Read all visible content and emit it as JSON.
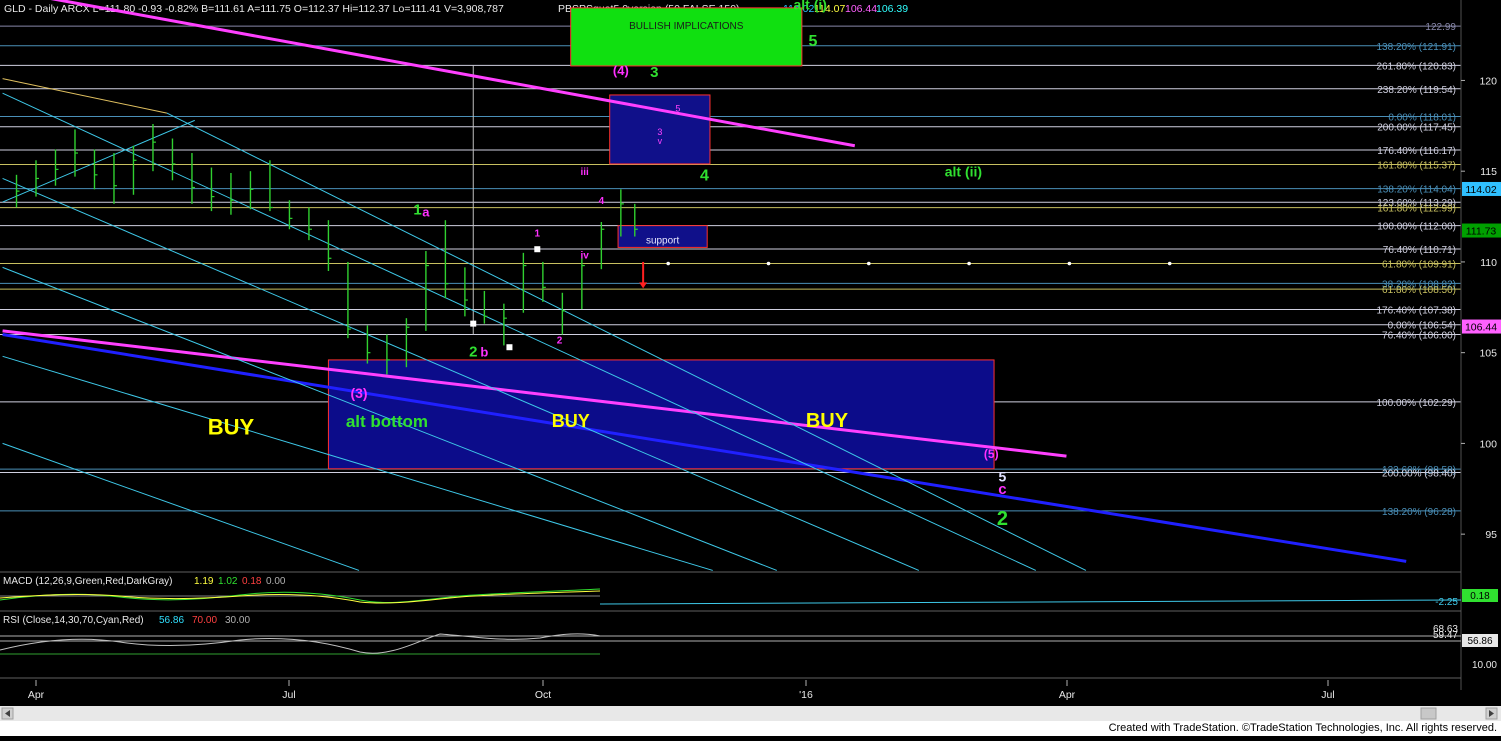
{
  "window": {
    "symbol_line": "GLD - Daily  ARCX  L=111.80  -0.93  -0.82%  B=111.61  A=111.75  O=112.37  Hi=112.37  Lo=111.41  V=3,908,787",
    "study_name": "PBSPSquat5.0version (50,FALSE,150)",
    "study_values": [
      "114.02",
      "114.07",
      "106.44",
      "106.39"
    ],
    "study_value_colors": [
      "#30c0ff",
      "#ffff40",
      "#ff60ff",
      "#30ffff"
    ],
    "footer": "Created with TradeStation. ©TradeStation Technologies, Inc. All rights reserved."
  },
  "chart_data": {
    "type": "candlestick",
    "symbol": "GLD",
    "interval": "Daily",
    "ylim": [
      93,
      124
    ],
    "y_ticks": [
      95,
      100,
      105,
      110,
      115,
      120
    ],
    "x_ticks": [
      "Apr",
      "Jul",
      "Oct",
      "'16",
      "Apr",
      "Jul"
    ],
    "last_price": 111.73,
    "price_tags": [
      {
        "value": 114.02,
        "label": "114.02",
        "color": "#30c0ff"
      },
      {
        "value": 111.73,
        "label": "111.73",
        "color": "#00a000"
      },
      {
        "value": 106.44,
        "label": "106.44",
        "color": "#ff60ff"
      }
    ],
    "fib_levels": [
      {
        "value": 122.99,
        "label": "122.99",
        "color": "#8888aa"
      },
      {
        "value": 121.91,
        "label": "138.20% (121.91)",
        "color": "#4a8fb8"
      },
      {
        "value": 120.83,
        "label": "261.80% (120.83)",
        "color": "#d0d0e0"
      },
      {
        "value": 119.54,
        "label": "238.20% (119.54)",
        "color": "#d0d0e0"
      },
      {
        "value": 118.01,
        "label": "0.00% (118.01)",
        "color": "#4a8fb8"
      },
      {
        "value": 117.45,
        "label": "200.00% (117.45)",
        "color": "#d0d0e0"
      },
      {
        "value": 116.17,
        "label": "176.40% (116.17)",
        "color": "#d0d0e0"
      },
      {
        "value": 115.37,
        "label": "161.80% (115.37)",
        "color": "#c8c060"
      },
      {
        "value": 114.04,
        "label": "138.20% (114.04)",
        "color": "#4a8fb8"
      },
      {
        "value": 113.29,
        "label": "123.60% (113.29)",
        "color": "#d0d0e0"
      },
      {
        "value": 112.99,
        "label": "161.80% (112.99)",
        "color": "#c8c060"
      },
      {
        "value": 112.0,
        "label": "100.00% (112.00)",
        "color": "#d0d0e0"
      },
      {
        "value": 110.71,
        "label": "76.40% (110.71)",
        "color": "#d0d0e0"
      },
      {
        "value": 109.91,
        "label": "61.80% (109.91)",
        "color": "#c8c060"
      },
      {
        "value": 108.82,
        "label": "38.20% (108.82)",
        "color": "#4a8fb8"
      },
      {
        "value": 108.5,
        "label": "61.80% (108.50)",
        "color": "#c8c060"
      },
      {
        "value": 107.38,
        "label": "176.40% (107.38)",
        "color": "#d0d0e0"
      },
      {
        "value": 106.54,
        "label": "0.00% (106.54)",
        "color": "#d0d0e0"
      },
      {
        "value": 106.0,
        "label": "76.40% (106.00)",
        "color": "#d0d0e0"
      },
      {
        "value": 102.29,
        "label": "100.00% (102.29)",
        "color": "#d0d0e0"
      },
      {
        "value": 98.58,
        "label": "123.60% (98.58)",
        "color": "#4a8fb8"
      },
      {
        "value": 98.4,
        "label": "200.00% (98.40)",
        "color": "#d0d0e0"
      },
      {
        "value": 96.28,
        "label": "138.20% (96.28)",
        "color": "#4a8fb8"
      }
    ],
    "price_bars": [
      {
        "date": "2015-03-25",
        "high": 114.8,
        "low": 113.0,
        "close": 113.9
      },
      {
        "date": "2015-04-01",
        "high": 115.6,
        "low": 113.6,
        "close": 114.6
      },
      {
        "date": "2015-04-08",
        "high": 116.2,
        "low": 114.2,
        "close": 115.1
      },
      {
        "date": "2015-04-15",
        "high": 117.3,
        "low": 114.7,
        "close": 116.0
      },
      {
        "date": "2015-04-22",
        "high": 116.2,
        "low": 114.0,
        "close": 114.8
      },
      {
        "date": "2015-04-29",
        "high": 116.0,
        "low": 113.2,
        "close": 114.2
      },
      {
        "date": "2015-05-06",
        "high": 116.4,
        "low": 113.7,
        "close": 115.6
      },
      {
        "date": "2015-05-13",
        "high": 117.6,
        "low": 115.0,
        "close": 116.6
      },
      {
        "date": "2015-05-20",
        "high": 116.8,
        "low": 114.5,
        "close": 115.4
      },
      {
        "date": "2015-05-27",
        "high": 116.0,
        "low": 113.2,
        "close": 114.1
      },
      {
        "date": "2015-06-03",
        "high": 115.2,
        "low": 112.8,
        "close": 113.6
      },
      {
        "date": "2015-06-10",
        "high": 114.9,
        "low": 112.6,
        "close": 113.4
      },
      {
        "date": "2015-06-17",
        "high": 115.0,
        "low": 112.9,
        "close": 114.0
      },
      {
        "date": "2015-06-24",
        "high": 115.6,
        "low": 112.8,
        "close": 113.0
      },
      {
        "date": "2015-07-01",
        "high": 113.4,
        "low": 111.8,
        "close": 112.4
      },
      {
        "date": "2015-07-08",
        "high": 113.0,
        "low": 111.2,
        "close": 111.8
      },
      {
        "date": "2015-07-15",
        "high": 112.3,
        "low": 109.5,
        "close": 110.2
      },
      {
        "date": "2015-07-22",
        "high": 110.0,
        "low": 105.8,
        "close": 106.3
      },
      {
        "date": "2015-07-29",
        "high": 106.5,
        "low": 104.4,
        "close": 105.0
      },
      {
        "date": "2015-08-05",
        "high": 106.0,
        "low": 103.8,
        "close": 104.6
      },
      {
        "date": "2015-08-12",
        "high": 106.9,
        "low": 104.2,
        "close": 106.4
      },
      {
        "date": "2015-08-19",
        "high": 110.6,
        "low": 106.2,
        "close": 109.8
      },
      {
        "date": "2015-08-26",
        "high": 112.3,
        "low": 108.0,
        "close": 108.8
      },
      {
        "date": "2015-09-02",
        "high": 109.7,
        "low": 107.0,
        "close": 107.9
      },
      {
        "date": "2015-09-09",
        "high": 108.4,
        "low": 106.6,
        "close": 107.0
      },
      {
        "date": "2015-09-16",
        "high": 107.7,
        "low": 105.4,
        "close": 106.9
      },
      {
        "date": "2015-09-23",
        "high": 110.5,
        "low": 107.2,
        "close": 109.8
      },
      {
        "date": "2015-09-30",
        "high": 110.0,
        "low": 107.8,
        "close": 108.6
      },
      {
        "date": "2015-10-07",
        "high": 108.3,
        "low": 106.0,
        "close": 107.3
      },
      {
        "date": "2015-10-14",
        "high": 110.2,
        "low": 107.4,
        "close": 109.8
      },
      {
        "date": "2015-10-21",
        "high": 112.2,
        "low": 109.6,
        "close": 111.8
      },
      {
        "date": "2015-10-28",
        "high": 114.0,
        "low": 111.4,
        "close": 113.2
      },
      {
        "date": "2015-11-02",
        "high": 113.2,
        "low": 111.4,
        "close": 111.8
      }
    ],
    "buy_zone": {
      "date_start": "2015-07-15",
      "date_end": "2016-03-10",
      "value_top": 104.6,
      "value_bottom": 98.6
    },
    "bullish_box": {
      "label": "BULLISH IMPLICATIONS",
      "date_start": "2015-10-10",
      "date_end": "2016-01-01",
      "value_top": 124.0,
      "value_bottom": 120.8
    },
    "target_box": {
      "labels": [
        "5",
        "3",
        "v"
      ],
      "date_start": "2015-10-24",
      "date_end": "2015-11-29",
      "value_top": 119.2,
      "value_bottom": 115.4
    },
    "support_box": {
      "label": "support",
      "date_start": "2015-10-27",
      "date_end": "2015-11-28",
      "value_top": 112.0,
      "value_bottom": 110.8
    },
    "dotted_level": {
      "value": 109.91,
      "date_start": "2015-11-14",
      "date_end": "2016-06-15"
    },
    "down_arrow": {
      "date": "2015-11-05",
      "value_from": 110.0,
      "value_to": 108.6
    },
    "trendlines": [
      {
        "color": "#ff40ff",
        "width": 3,
        "from": [
          "2015-03-20",
          125.0
        ],
        "to": [
          "2016-01-20",
          116.4
        ]
      },
      {
        "color": "#ff40ff",
        "width": 3,
        "from": [
          "2015-03-20",
          106.2
        ],
        "to": [
          "2016-04-05",
          99.3
        ]
      },
      {
        "color": "#2020ff",
        "width": 3,
        "from": [
          "2015-03-20",
          106.0
        ],
        "to": [
          "2016-08-05",
          93.5
        ]
      },
      {
        "color": "#3ec8e8",
        "width": 1,
        "from": [
          "2015-03-20",
          113.3
        ],
        "to": [
          "2015-05-28",
          117.8
        ]
      },
      {
        "color": "#3ec8e8",
        "width": 1,
        "from": [
          "2015-03-20",
          119.3
        ],
        "to": [
          "2016-03-25",
          93.0
        ]
      },
      {
        "color": "#3ec8e8",
        "width": 1,
        "from": [
          "2015-03-20",
          114.6
        ],
        "to": [
          "2016-02-12",
          93.0
        ]
      },
      {
        "color": "#3ec8e8",
        "width": 1,
        "from": [
          "2015-03-20",
          109.7
        ],
        "to": [
          "2015-12-23",
          93.0
        ]
      },
      {
        "color": "#3ec8e8",
        "width": 1,
        "from": [
          "2015-03-20",
          104.8
        ],
        "to": [
          "2015-11-30",
          93.0
        ]
      },
      {
        "color": "#3ec8e8",
        "width": 1,
        "from": [
          "2015-03-20",
          100.0
        ],
        "to": [
          "2015-07-26",
          93.0
        ]
      },
      {
        "color": "#3ec8e8",
        "width": 1,
        "from": [
          "2015-05-18",
          118.2
        ],
        "to": [
          "2016-04-12",
          93.0
        ]
      },
      {
        "color": "#e0c060",
        "width": 1,
        "from": [
          "2015-03-20",
          120.1
        ],
        "to": [
          "2015-05-18",
          118.2
        ]
      }
    ],
    "markers": [
      {
        "date": "2015-09-05",
        "value": 106.6
      },
      {
        "date": "2015-09-18",
        "value": 105.3
      },
      {
        "date": "2015-09-28",
        "value": 110.7
      }
    ],
    "annotations": [
      {
        "text": "alt (i)",
        "date": "2016-01-04",
        "value": 123.9,
        "color": "#30e030",
        "size": 14
      },
      {
        "text": "5",
        "date": "2016-01-05",
        "value": 121.9,
        "color": "#30e030",
        "size": 16
      },
      {
        "text": "(4)",
        "date": "2015-10-28",
        "value": 120.3,
        "color": "#ff30ff",
        "size": 13
      },
      {
        "text": "3",
        "date": "2015-11-09",
        "value": 120.2,
        "color": "#30e030",
        "size": 15
      },
      {
        "text": "4",
        "date": "2015-11-27",
        "value": 114.5,
        "color": "#30e030",
        "size": 16
      },
      {
        "text": "alt (ii)",
        "date": "2016-02-28",
        "value": 114.7,
        "color": "#30e030",
        "size": 14
      },
      {
        "text": "iii",
        "date": "2015-10-15",
        "value": 114.8,
        "color": "#ff30ff",
        "size": 10
      },
      {
        "text": "4",
        "date": "2015-10-21",
        "value": 113.2,
        "color": "#ff30ff",
        "size": 10
      },
      {
        "text": "iv",
        "date": "2015-10-15",
        "value": 110.2,
        "color": "#ff30ff",
        "size": 10
      },
      {
        "text": "1",
        "date": "2015-08-16",
        "value": 112.6,
        "color": "#30e030",
        "size": 15
      },
      {
        "text": "a",
        "date": "2015-08-19",
        "value": 112.5,
        "color": "#ff30ff",
        "size": 13
      },
      {
        "text": "1",
        "date": "2015-09-28",
        "value": 111.4,
        "color": "#ff30ff",
        "size": 10
      },
      {
        "text": "2",
        "date": "2015-09-05",
        "value": 104.8,
        "color": "#30e030",
        "size": 15
      },
      {
        "text": "b",
        "date": "2015-09-09",
        "value": 104.8,
        "color": "#ff30ff",
        "size": 13
      },
      {
        "text": "2",
        "date": "2015-10-06",
        "value": 105.5,
        "color": "#ff30ff",
        "size": 10
      },
      {
        "text": "(3)",
        "date": "2015-07-26",
        "value": 102.5,
        "color": "#ff30ff",
        "size": 14
      },
      {
        "text": "(5)",
        "date": "2016-03-09",
        "value": 99.2,
        "color": "#ff30ff",
        "size": 12
      },
      {
        "text": "5",
        "date": "2016-03-13",
        "value": 97.9,
        "color": "#e0e0ff",
        "size": 14
      },
      {
        "text": "c",
        "date": "2016-03-13",
        "value": 97.2,
        "color": "#ff30ff",
        "size": 15
      },
      {
        "text": "2",
        "date": "2016-03-13",
        "value": 95.5,
        "color": "#30e030",
        "size": 20
      }
    ],
    "zone_labels": [
      {
        "text": "BUY",
        "date": "2015-06-10",
        "value": 100.5,
        "color": "#ffff00",
        "size": 22
      },
      {
        "text": "alt bottom",
        "date": "2015-08-05",
        "value": 100.9,
        "color": "#30e030",
        "size": 17
      },
      {
        "text": "BUY",
        "date": "2015-10-10",
        "value": 100.9,
        "color": "#ffff00",
        "size": 18
      },
      {
        "text": "BUY",
        "date": "2016-01-10",
        "value": 100.9,
        "color": "#ffff00",
        "size": 20
      }
    ]
  },
  "macd_panel": {
    "title": "MACD (12,26,9,Green,Red,DarkGray)",
    "values": [
      "1.19",
      "1.02",
      "0.18",
      "0.00"
    ],
    "value_colors": [
      "#ffff40",
      "#30e030",
      "#ff4040",
      "#b0b0b0"
    ],
    "right_label": "-2.25",
    "price_tag": "0.18"
  },
  "rsi_panel": {
    "title": "RSI (Close,14,30,70,Cyan,Red)",
    "values": [
      "56.86",
      "70.00",
      "30.00"
    ],
    "value_colors": [
      "#30e0ff",
      "#ff4040",
      "#b0b0b0"
    ],
    "right_labels": [
      "68.63",
      "59.47"
    ],
    "scale_label": "10.00",
    "price_tag": "56.86"
  }
}
